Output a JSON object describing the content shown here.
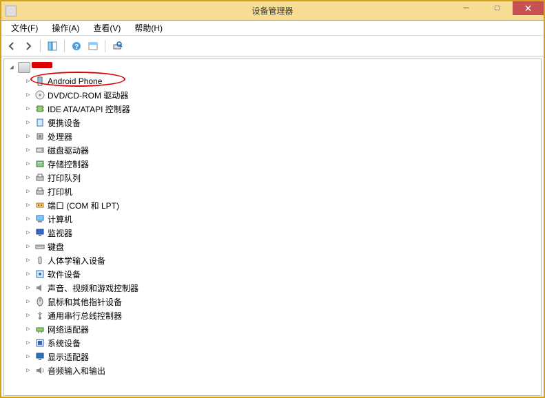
{
  "window": {
    "title": "设备管理器"
  },
  "menubar": {
    "file": "文件(F)",
    "action": "操作(A)",
    "view": "查看(V)",
    "help": "帮助(H)"
  },
  "tree": {
    "root_label": "",
    "items": [
      {
        "label": "Android Phone",
        "icon": "phone"
      },
      {
        "label": "DVD/CD-ROM 驱动器",
        "icon": "disc"
      },
      {
        "label": "IDE ATA/ATAPI 控制器",
        "icon": "chip"
      },
      {
        "label": "便携设备",
        "icon": "portable"
      },
      {
        "label": "处理器",
        "icon": "cpu"
      },
      {
        "label": "磁盘驱动器",
        "icon": "disk"
      },
      {
        "label": "存储控制器",
        "icon": "storage"
      },
      {
        "label": "打印队列",
        "icon": "printqueue"
      },
      {
        "label": "打印机",
        "icon": "printer"
      },
      {
        "label": "端口 (COM 和 LPT)",
        "icon": "port"
      },
      {
        "label": "计算机",
        "icon": "computer"
      },
      {
        "label": "监视器",
        "icon": "monitor"
      },
      {
        "label": "键盘",
        "icon": "keyboard"
      },
      {
        "label": "人体学输入设备",
        "icon": "hid"
      },
      {
        "label": "软件设备",
        "icon": "software"
      },
      {
        "label": "声音、视频和游戏控制器",
        "icon": "sound"
      },
      {
        "label": "鼠标和其他指针设备",
        "icon": "mouse"
      },
      {
        "label": "通用串行总线控制器",
        "icon": "usb"
      },
      {
        "label": "网络适配器",
        "icon": "network"
      },
      {
        "label": "系统设备",
        "icon": "system"
      },
      {
        "label": "显示适配器",
        "icon": "display"
      },
      {
        "label": "音频输入和输出",
        "icon": "audio"
      }
    ]
  }
}
